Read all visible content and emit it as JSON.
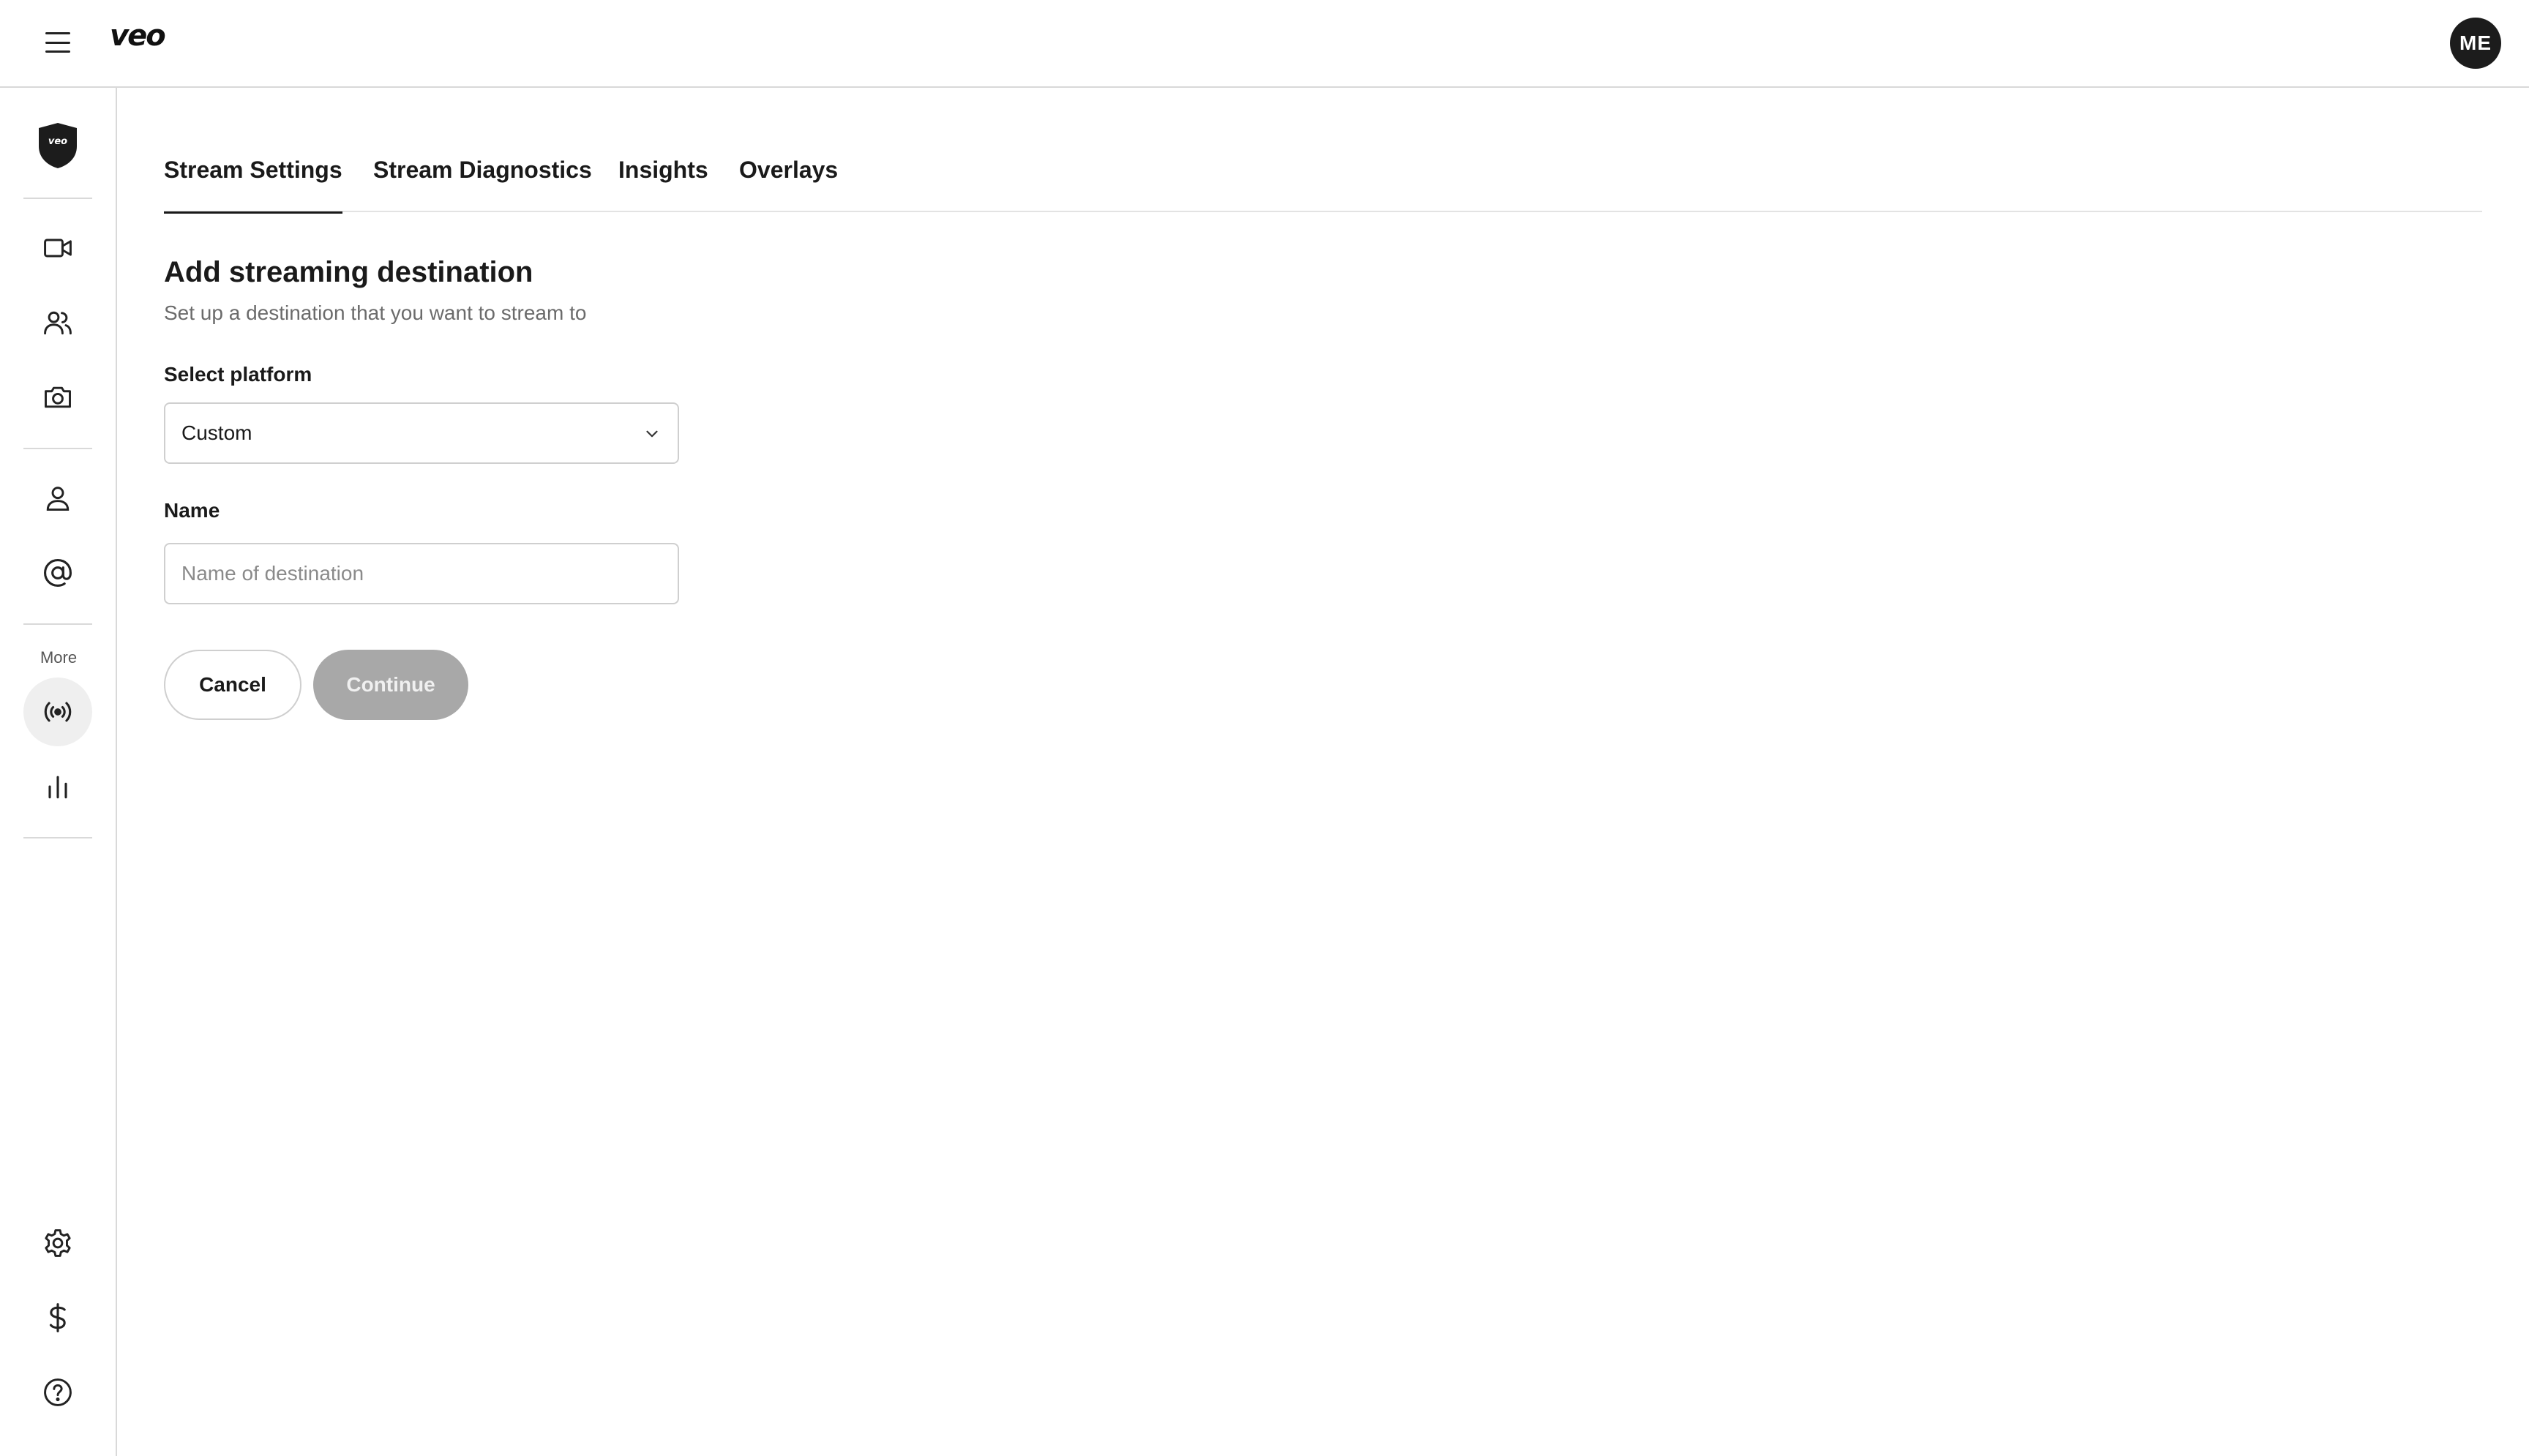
{
  "header": {
    "logo": "veo",
    "avatar_initials": "ME"
  },
  "sidebar": {
    "shield_logo_text": "veo",
    "more_label": "More",
    "items": [
      {
        "icon": "video-camera-icon"
      },
      {
        "icon": "users-icon"
      },
      {
        "icon": "camera-icon"
      },
      {
        "icon": "person-icon"
      },
      {
        "icon": "at-sign-icon"
      },
      {
        "icon": "broadcast-icon",
        "active": true
      },
      {
        "icon": "bar-chart-icon"
      },
      {
        "icon": "settings-icon"
      },
      {
        "icon": "dollar-icon"
      },
      {
        "icon": "help-icon"
      }
    ]
  },
  "tabs": [
    {
      "label": "Stream Settings",
      "active": true
    },
    {
      "label": "Stream Diagnostics"
    },
    {
      "label": "Insights"
    },
    {
      "label": "Overlays"
    }
  ],
  "form": {
    "title": "Add streaming destination",
    "subtitle": "Set up a destination that you want to stream to",
    "platform_label": "Select platform",
    "platform_value": "Custom",
    "name_label": "Name",
    "name_placeholder": "Name of destination",
    "name_value": "",
    "cancel_label": "Cancel",
    "continue_label": "Continue"
  },
  "colors": {
    "accent": "#1a1a1a",
    "disabled_button": "#a8a8a8",
    "border": "#d9d9d9"
  }
}
